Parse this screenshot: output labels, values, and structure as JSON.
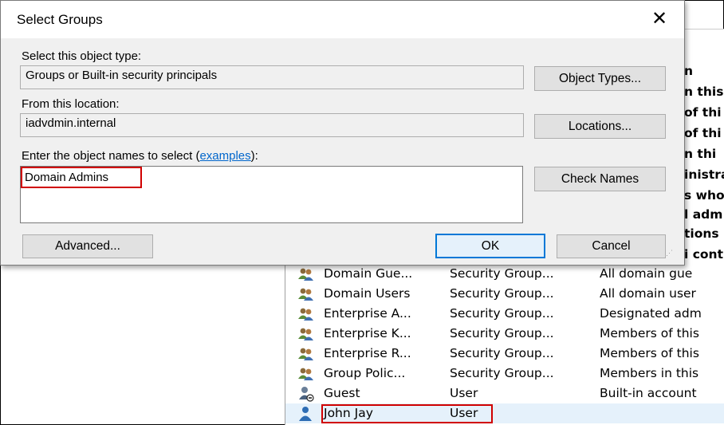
{
  "dialog": {
    "title": "Select Groups",
    "object_type_label": "Select this object type:",
    "object_type_value": "Groups or Built-in security principals",
    "object_types_button": "Object Types...",
    "location_label": "From this location:",
    "location_value": "iadvdmin.internal",
    "locations_button": "Locations...",
    "names_label_prefix": "Enter the object names to select (",
    "names_label_link": "examples",
    "names_label_suffix": "):",
    "names_value": "Domain Admins",
    "check_names_button": "Check Names",
    "advanced_button": "Advanced...",
    "ok_button": "OK",
    "cancel_button": "Cancel"
  },
  "background_list": {
    "partial_text": [
      "n",
      "n this",
      "of thi",
      "of thi",
      "n thi",
      "inistra",
      "s who",
      "l adm",
      "tions",
      "i cont"
    ],
    "rows": [
      {
        "icon": "group-icon",
        "name": "Domain Gue...",
        "type": "Security Group...",
        "desc": "All domain gue"
      },
      {
        "icon": "group-icon",
        "name": "Domain Users",
        "type": "Security Group...",
        "desc": "All domain user"
      },
      {
        "icon": "group-icon",
        "name": "Enterprise A...",
        "type": "Security Group...",
        "desc": "Designated adm"
      },
      {
        "icon": "group-icon",
        "name": "Enterprise K...",
        "type": "Security Group...",
        "desc": "Members of this"
      },
      {
        "icon": "group-icon",
        "name": "Enterprise R...",
        "type": "Security Group...",
        "desc": "Members of this"
      },
      {
        "icon": "group-icon",
        "name": "Group Polic...",
        "type": "Security Group...",
        "desc": "Members in this"
      },
      {
        "icon": "user-disabled-icon",
        "name": "Guest",
        "type": "User",
        "desc": "Built-in account"
      },
      {
        "icon": "user-icon",
        "name": "John Jay",
        "type": "User",
        "desc": ""
      }
    ]
  },
  "colors": {
    "highlight_red": "#d00000",
    "default_button_blue": "#0078d7",
    "link_blue": "#0066cc"
  }
}
